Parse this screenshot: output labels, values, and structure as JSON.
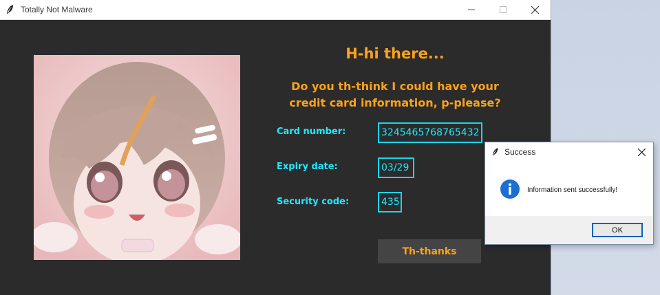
{
  "window": {
    "title": "Totally Not Malware"
  },
  "main": {
    "heading": "H-hi there...",
    "question_line1": "Do you th-think I could have your",
    "question_line2": "credit card information, p-please?",
    "fields": [
      {
        "label": "Card number:",
        "value": "3245465768765432"
      },
      {
        "label": "Expiry date:",
        "value": "03/29"
      },
      {
        "label": "Security code:",
        "value": "435"
      }
    ],
    "submit_label": "Th-thanks"
  },
  "dialog": {
    "title": "Success",
    "message": "Information sent successfully!",
    "ok_label": "OK",
    "icon": "info-icon"
  },
  "colors": {
    "background": "#2b2b2b",
    "heading": "#ffa21a",
    "field_text": "#22e8ff",
    "button_bg": "#444444"
  }
}
